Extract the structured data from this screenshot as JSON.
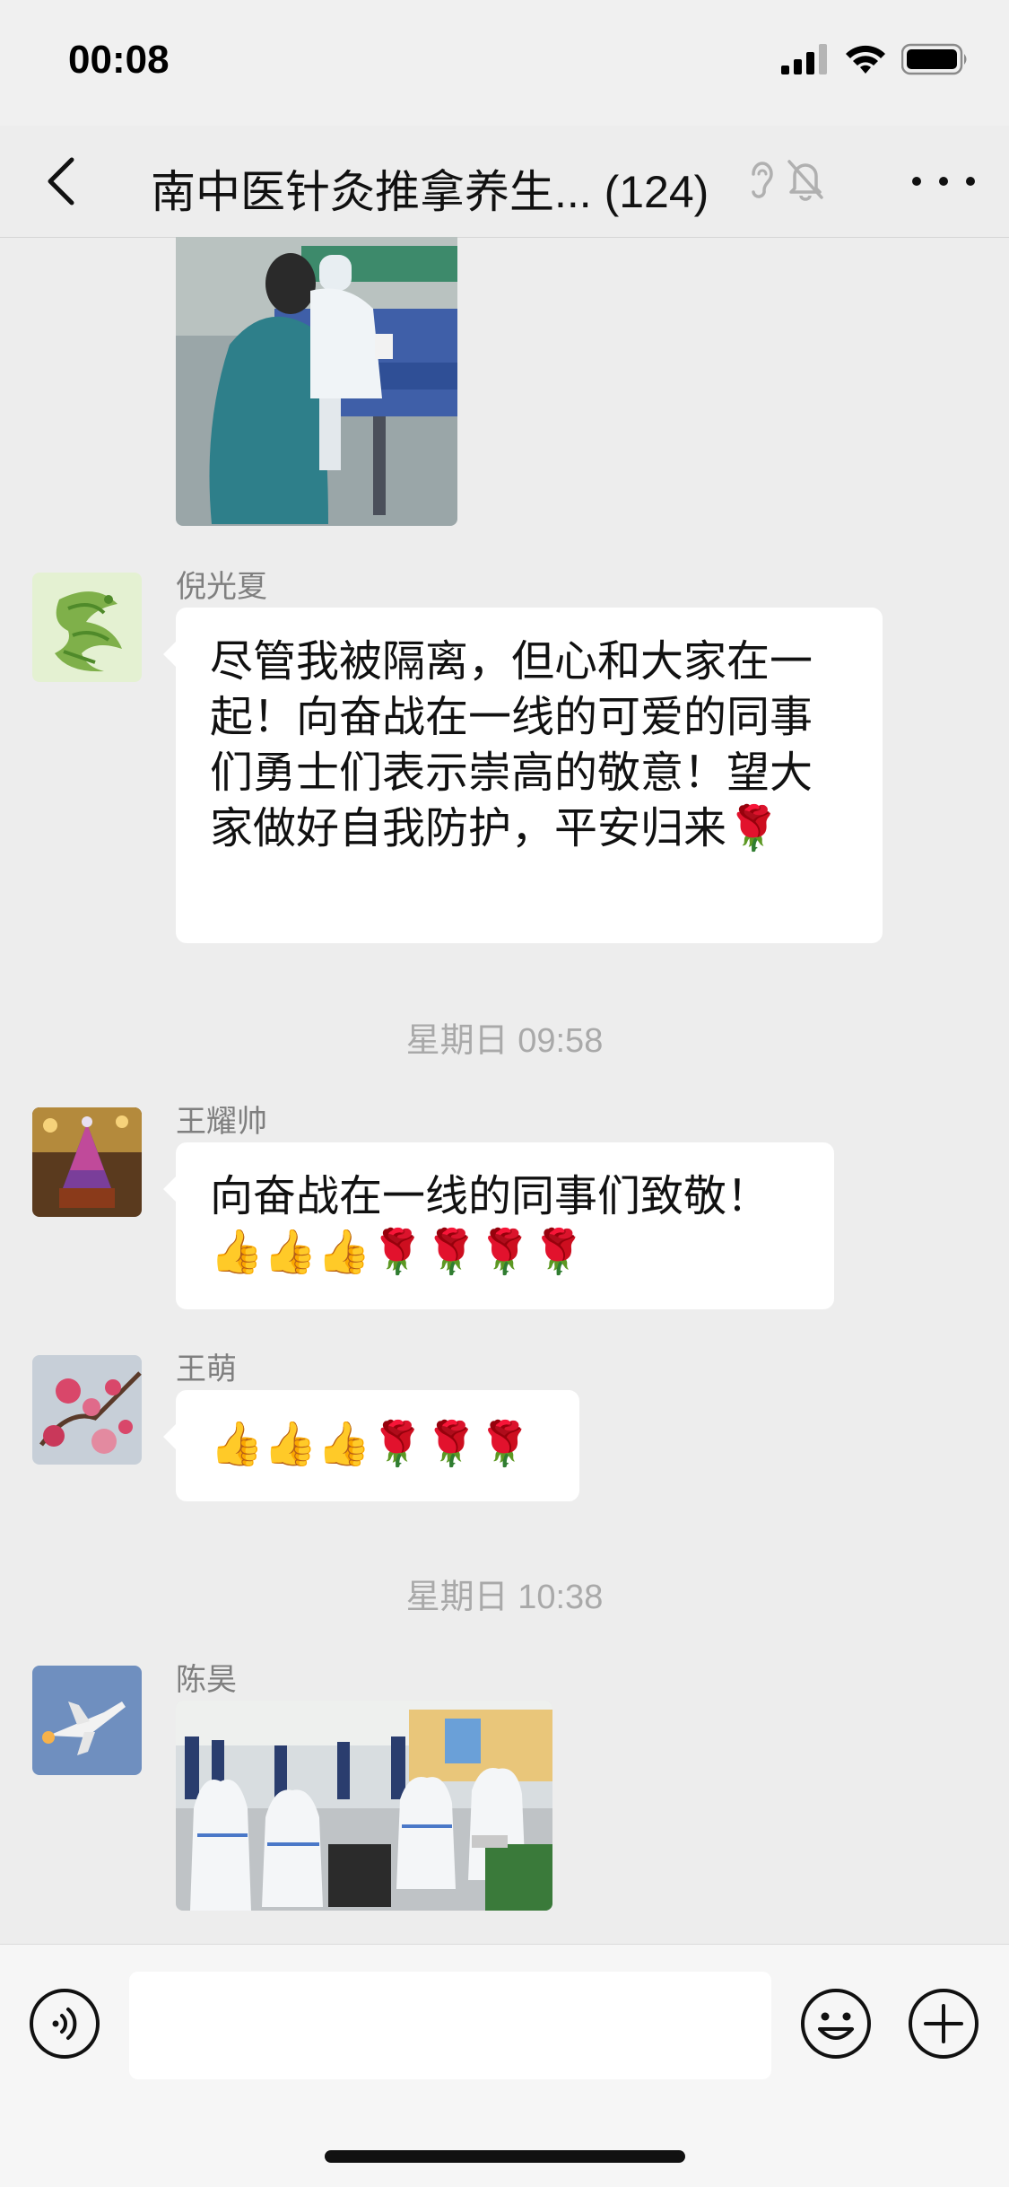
{
  "status_bar": {
    "time": "00:08"
  },
  "header": {
    "title": "南中医针灸推拿养生... (124)"
  },
  "messages": [
    {
      "sender": "倪光夏",
      "text": "尽管我被隔离，但心和大家在一起！向奋战在一线的可爱的同事们勇士们表示崇高的敬意！望大家做好自我防护，平安归来🌹"
    },
    {
      "sender": "王耀帅",
      "text": "向奋战在一线的同事们致敬！👍👍👍🌹🌹🌹🌹"
    },
    {
      "sender": "王萌",
      "text": "👍👍👍🌹🌹🌹"
    },
    {
      "sender": "陈昊"
    }
  ],
  "timestamps": [
    "星期日 09:58",
    "星期日 10:38"
  ],
  "input": {
    "placeholder": ""
  },
  "icons": {
    "back": "chevron-left-icon",
    "ear": "ear-icon",
    "mute": "bell-mute-icon",
    "more": "more-dots-icon",
    "voice": "voice-icon",
    "emoji": "emoji-icon",
    "plus": "plus-icon"
  }
}
